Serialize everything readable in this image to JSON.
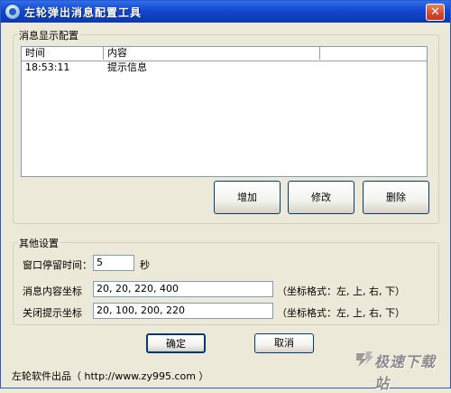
{
  "window": {
    "title": "左轮弹出消息配置工具",
    "close_glyph": "✕"
  },
  "message_group": {
    "label": "消息显示配置",
    "columns": [
      "时间",
      "内容",
      ""
    ],
    "rows": [
      {
        "time": "18:53:11",
        "content": "提示信息"
      }
    ],
    "buttons": {
      "add": "增加",
      "edit": "修改",
      "delete": "删除"
    }
  },
  "other_group": {
    "label": "其他设置",
    "stay_time_label": "窗口停留时间：",
    "stay_time_value": "5",
    "stay_time_unit": "秒",
    "content_coord_label": "消息内容坐标",
    "content_coord_value": "20, 20, 220, 400",
    "content_coord_hint": "（坐标格式：左, 上, 右, 下）",
    "close_coord_label": "关闭提示坐标",
    "close_coord_value": "20, 100, 200, 220",
    "close_coord_hint": "（坐标格式：左, 上, 右, 下）"
  },
  "dialog_buttons": {
    "ok": "确定",
    "cancel": "取消"
  },
  "footer": {
    "credit": "左轮软件出品（ http://www.zy995.com ）"
  },
  "watermark": {
    "text": "极速下载站"
  }
}
